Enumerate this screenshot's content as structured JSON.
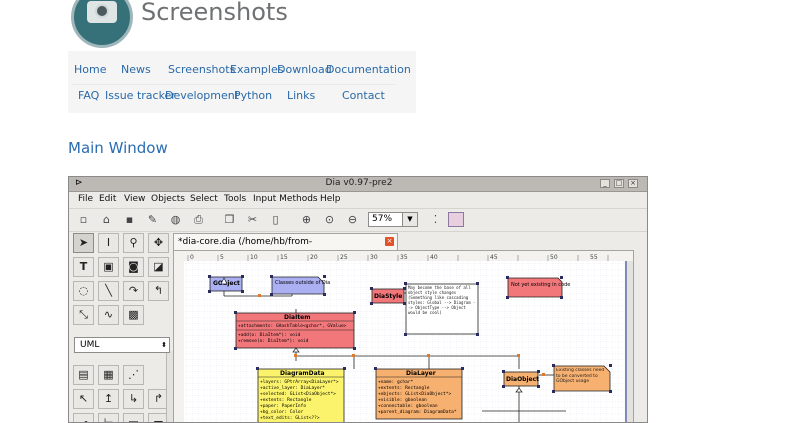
{
  "header": {
    "title": "Screenshots"
  },
  "nav": {
    "row1": [
      "Home",
      "News",
      "Screenshots",
      "Examples",
      "Download",
      "Documentation"
    ],
    "row2": [
      "FAQ",
      "Issue tracker",
      "Development",
      "Python",
      "Links",
      "Contact"
    ]
  },
  "section": {
    "title": "Main Window"
  },
  "window": {
    "title": "Dia v0.97-pre2",
    "menus": [
      "File",
      "Edit",
      "View",
      "Objects",
      "Select",
      "Tools",
      "Input Methods",
      "Help"
    ],
    "zoom": "57%",
    "sheet": "UML",
    "tab": "*dia-core.dia (/home/hb/from-svn/dia/samples/Self)",
    "ruler_labels": [
      "0",
      "5",
      "10",
      "15",
      "20",
      "25",
      "30",
      "35",
      "40",
      "45",
      "50",
      "55"
    ],
    "classes": {
      "gobject": "GObject",
      "classes_outside": "Classes outside of Dia",
      "diastyle": "DiaStyle",
      "note": "May become the base of all object style changes (Something like cascading styles: Global --> Diagram --> ObjectType --> Object would be cool)",
      "not_existing": "Not yet existing in code",
      "diaitem": "DiaItem",
      "diaitem_attr": "+attachments: GHashTable<gchar*, GValue>",
      "diaitem_op1": "+add(o: DiaItem*): void",
      "diaitem_op2": "+remove(o: DiaItem*): void",
      "diagramdata": "DiagramData",
      "diagramdata_attrs": [
        "+layers: GPtrArray<DiaLayer*>",
        "+active_layer: DiaLayer*",
        "+selected: GList<DiaObject*>",
        "+extents: Rectangle",
        "+paper: PaperInfo",
        "+bg_color: Color",
        "+text_edits: GList<??>"
      ],
      "dialayer": "DiaLayer",
      "dialayer_attrs": [
        "+name: gchar*",
        "+extents: Rectangle",
        "+objects: GList<DiaObject*>",
        "+visible: gboolean",
        "+connectable: gboolean",
        "+parent_diagram: DiagramData*"
      ],
      "diaobject": "DiaObject",
      "existing_note": "Existing classes need to be converted to GObject usage"
    }
  },
  "colors": {
    "link": "#2a69a8",
    "titlebar": "#bcb9b4"
  },
  "icons": {
    "close_tab": "close-icon"
  }
}
